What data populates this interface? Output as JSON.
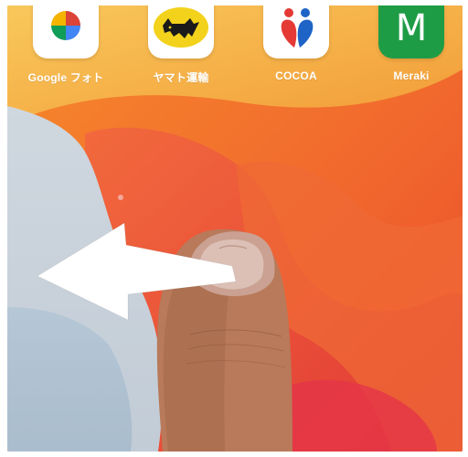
{
  "home_screen": {
    "apps": [
      {
        "label": "Google フォト",
        "icon": "pinwheel-icon"
      },
      {
        "label": "ヤマト運輸",
        "icon": "black-cat-icon"
      },
      {
        "label": "COCOA",
        "icon": "hug-figures-icon"
      },
      {
        "label": "Meraki",
        "icon": "m-letter-icon",
        "glyph": "M"
      }
    ]
  },
  "gesture": {
    "direction": "left",
    "type": "swipe"
  },
  "colors": {
    "wallpaper_orange": "#f26d2d",
    "wallpaper_yellow": "#f7b03a",
    "wallpaper_red": "#e8383e",
    "wallpaper_gray": "#d7dde3",
    "arrow": "#ffffff",
    "meraki_green": "#1e9c45"
  }
}
